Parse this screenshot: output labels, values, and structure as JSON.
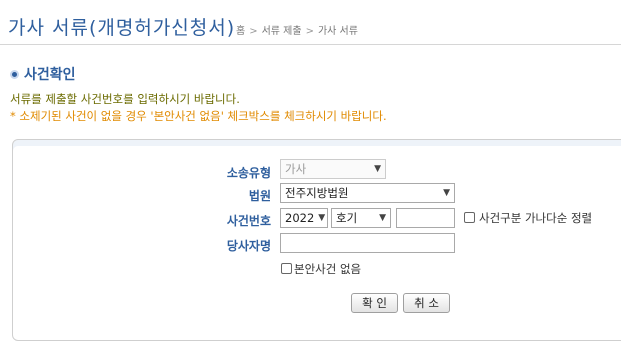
{
  "header": {
    "title": "가사 서류(개명허가신청서)",
    "breadcrumb": [
      "홈",
      "서류 제출",
      "가사 서류"
    ],
    "breadcrumb_sep": ">"
  },
  "section": {
    "title": "사건확인"
  },
  "notices": {
    "line1": "서류를 제출할 사건번호를 입력하시기 바랍니다.",
    "line2": "* 소제기된 사건이 없을 경우 '본안사건 없음' 체크박스를 체크하시기 바랍니다."
  },
  "form": {
    "case_type_label": "소송유형",
    "case_type_value": "가사",
    "court_label": "법원",
    "court_value": "전주지방법원",
    "case_number_label": "사건번호",
    "year_value": "2022",
    "case_code_value": "호기",
    "case_number_value": "",
    "sort_checkbox_label": "사건구분 가나다순 정렬",
    "party_name_label": "당사자명",
    "party_name_value": "",
    "no_case_checkbox_label": "본안사건 없음"
  },
  "buttons": {
    "confirm": "확 인",
    "cancel": "취 소"
  }
}
